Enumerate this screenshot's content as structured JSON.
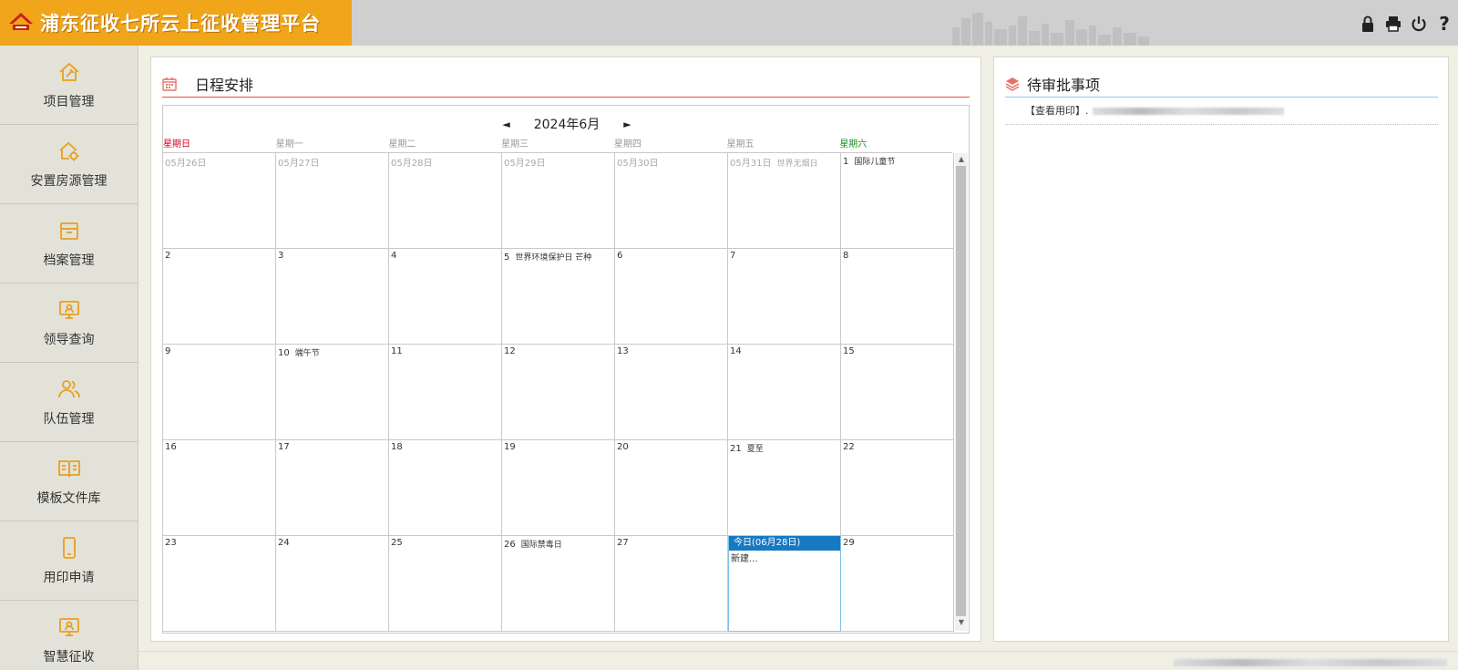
{
  "app": {
    "title": "浦东征收七所云上征收管理平台"
  },
  "sidebar": {
    "items": [
      {
        "label": "项目管理",
        "icon": "home-hammer-icon"
      },
      {
        "label": "安置房源管理",
        "icon": "house-gear-icon"
      },
      {
        "label": "档案管理",
        "icon": "archive-box-icon"
      },
      {
        "label": "领导查询",
        "icon": "monitor-user-icon"
      },
      {
        "label": "队伍管理",
        "icon": "team-users-icon"
      },
      {
        "label": "模板文件库",
        "icon": "open-book-icon"
      },
      {
        "label": "用印申请",
        "icon": "mobile-phone-icon"
      },
      {
        "label": "智慧征收",
        "icon": "monitor-user-icon"
      }
    ]
  },
  "header_icons": [
    "lock-icon",
    "print-icon",
    "power-icon",
    "help-icon"
  ],
  "schedule": {
    "title": "日程安排",
    "month_label": "2024年6月",
    "prev": "◄",
    "next": "►",
    "weekdays": [
      "星期日",
      "星期一",
      "星期二",
      "星期三",
      "星期四",
      "星期五",
      "星期六"
    ],
    "weeks": [
      [
        {
          "day": "05月26日",
          "event": "",
          "other": true
        },
        {
          "day": "05月27日",
          "event": "",
          "other": true
        },
        {
          "day": "05月28日",
          "event": "",
          "other": true
        },
        {
          "day": "05月29日",
          "event": "",
          "other": true
        },
        {
          "day": "05月30日",
          "event": "",
          "other": true
        },
        {
          "day": "05月31日",
          "event": "世界无烟日",
          "other": true
        },
        {
          "day": "1",
          "event": "国际儿童节",
          "other": false
        }
      ],
      [
        {
          "day": "2",
          "event": ""
        },
        {
          "day": "3",
          "event": ""
        },
        {
          "day": "4",
          "event": ""
        },
        {
          "day": "5",
          "event": "世界环境保护日 芒种"
        },
        {
          "day": "6",
          "event": ""
        },
        {
          "day": "7",
          "event": ""
        },
        {
          "day": "8",
          "event": ""
        }
      ],
      [
        {
          "day": "9",
          "event": ""
        },
        {
          "day": "10",
          "event": "端午节"
        },
        {
          "day": "11",
          "event": ""
        },
        {
          "day": "12",
          "event": ""
        },
        {
          "day": "13",
          "event": ""
        },
        {
          "day": "14",
          "event": ""
        },
        {
          "day": "15",
          "event": ""
        }
      ],
      [
        {
          "day": "16",
          "event": ""
        },
        {
          "day": "17",
          "event": ""
        },
        {
          "day": "18",
          "event": ""
        },
        {
          "day": "19",
          "event": ""
        },
        {
          "day": "20",
          "event": ""
        },
        {
          "day": "21",
          "event": "夏至"
        },
        {
          "day": "22",
          "event": ""
        }
      ],
      [
        {
          "day": "23",
          "event": ""
        },
        {
          "day": "24",
          "event": ""
        },
        {
          "day": "25",
          "event": ""
        },
        {
          "day": "26",
          "event": "国际禁毒日"
        },
        {
          "day": "27",
          "event": ""
        },
        {
          "day": "今日(06月28日)",
          "event": "新建...",
          "today": true
        },
        {
          "day": "29",
          "event": ""
        }
      ]
    ]
  },
  "pending": {
    "title": "待审批事项",
    "items": [
      {
        "label": "【查看用印】."
      }
    ]
  },
  "colors": {
    "accent": "#f0a51a",
    "today": "#1779c2",
    "schedule_rule": "#e0523b",
    "pending_rule": "#93c9e6",
    "sunday": "#d9001b",
    "saturday": "#1f8a1f"
  }
}
